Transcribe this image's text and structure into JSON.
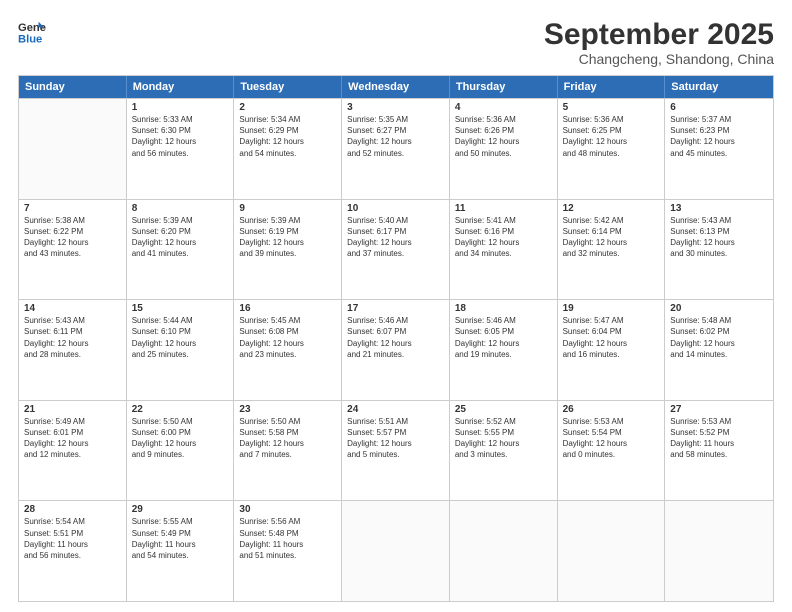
{
  "header": {
    "logo_line1": "General",
    "logo_line2": "Blue",
    "month": "September 2025",
    "location": "Changcheng, Shandong, China"
  },
  "weekdays": [
    "Sunday",
    "Monday",
    "Tuesday",
    "Wednesday",
    "Thursday",
    "Friday",
    "Saturday"
  ],
  "rows": [
    [
      {
        "day": "",
        "info": ""
      },
      {
        "day": "1",
        "info": "Sunrise: 5:33 AM\nSunset: 6:30 PM\nDaylight: 12 hours\nand 56 minutes."
      },
      {
        "day": "2",
        "info": "Sunrise: 5:34 AM\nSunset: 6:29 PM\nDaylight: 12 hours\nand 54 minutes."
      },
      {
        "day": "3",
        "info": "Sunrise: 5:35 AM\nSunset: 6:27 PM\nDaylight: 12 hours\nand 52 minutes."
      },
      {
        "day": "4",
        "info": "Sunrise: 5:36 AM\nSunset: 6:26 PM\nDaylight: 12 hours\nand 50 minutes."
      },
      {
        "day": "5",
        "info": "Sunrise: 5:36 AM\nSunset: 6:25 PM\nDaylight: 12 hours\nand 48 minutes."
      },
      {
        "day": "6",
        "info": "Sunrise: 5:37 AM\nSunset: 6:23 PM\nDaylight: 12 hours\nand 45 minutes."
      }
    ],
    [
      {
        "day": "7",
        "info": "Sunrise: 5:38 AM\nSunset: 6:22 PM\nDaylight: 12 hours\nand 43 minutes."
      },
      {
        "day": "8",
        "info": "Sunrise: 5:39 AM\nSunset: 6:20 PM\nDaylight: 12 hours\nand 41 minutes."
      },
      {
        "day": "9",
        "info": "Sunrise: 5:39 AM\nSunset: 6:19 PM\nDaylight: 12 hours\nand 39 minutes."
      },
      {
        "day": "10",
        "info": "Sunrise: 5:40 AM\nSunset: 6:17 PM\nDaylight: 12 hours\nand 37 minutes."
      },
      {
        "day": "11",
        "info": "Sunrise: 5:41 AM\nSunset: 6:16 PM\nDaylight: 12 hours\nand 34 minutes."
      },
      {
        "day": "12",
        "info": "Sunrise: 5:42 AM\nSunset: 6:14 PM\nDaylight: 12 hours\nand 32 minutes."
      },
      {
        "day": "13",
        "info": "Sunrise: 5:43 AM\nSunset: 6:13 PM\nDaylight: 12 hours\nand 30 minutes."
      }
    ],
    [
      {
        "day": "14",
        "info": "Sunrise: 5:43 AM\nSunset: 6:11 PM\nDaylight: 12 hours\nand 28 minutes."
      },
      {
        "day": "15",
        "info": "Sunrise: 5:44 AM\nSunset: 6:10 PM\nDaylight: 12 hours\nand 25 minutes."
      },
      {
        "day": "16",
        "info": "Sunrise: 5:45 AM\nSunset: 6:08 PM\nDaylight: 12 hours\nand 23 minutes."
      },
      {
        "day": "17",
        "info": "Sunrise: 5:46 AM\nSunset: 6:07 PM\nDaylight: 12 hours\nand 21 minutes."
      },
      {
        "day": "18",
        "info": "Sunrise: 5:46 AM\nSunset: 6:05 PM\nDaylight: 12 hours\nand 19 minutes."
      },
      {
        "day": "19",
        "info": "Sunrise: 5:47 AM\nSunset: 6:04 PM\nDaylight: 12 hours\nand 16 minutes."
      },
      {
        "day": "20",
        "info": "Sunrise: 5:48 AM\nSunset: 6:02 PM\nDaylight: 12 hours\nand 14 minutes."
      }
    ],
    [
      {
        "day": "21",
        "info": "Sunrise: 5:49 AM\nSunset: 6:01 PM\nDaylight: 12 hours\nand 12 minutes."
      },
      {
        "day": "22",
        "info": "Sunrise: 5:50 AM\nSunset: 6:00 PM\nDaylight: 12 hours\nand 9 minutes."
      },
      {
        "day": "23",
        "info": "Sunrise: 5:50 AM\nSunset: 5:58 PM\nDaylight: 12 hours\nand 7 minutes."
      },
      {
        "day": "24",
        "info": "Sunrise: 5:51 AM\nSunset: 5:57 PM\nDaylight: 12 hours\nand 5 minutes."
      },
      {
        "day": "25",
        "info": "Sunrise: 5:52 AM\nSunset: 5:55 PM\nDaylight: 12 hours\nand 3 minutes."
      },
      {
        "day": "26",
        "info": "Sunrise: 5:53 AM\nSunset: 5:54 PM\nDaylight: 12 hours\nand 0 minutes."
      },
      {
        "day": "27",
        "info": "Sunrise: 5:53 AM\nSunset: 5:52 PM\nDaylight: 11 hours\nand 58 minutes."
      }
    ],
    [
      {
        "day": "28",
        "info": "Sunrise: 5:54 AM\nSunset: 5:51 PM\nDaylight: 11 hours\nand 56 minutes."
      },
      {
        "day": "29",
        "info": "Sunrise: 5:55 AM\nSunset: 5:49 PM\nDaylight: 11 hours\nand 54 minutes."
      },
      {
        "day": "30",
        "info": "Sunrise: 5:56 AM\nSunset: 5:48 PM\nDaylight: 11 hours\nand 51 minutes."
      },
      {
        "day": "",
        "info": ""
      },
      {
        "day": "",
        "info": ""
      },
      {
        "day": "",
        "info": ""
      },
      {
        "day": "",
        "info": ""
      }
    ]
  ]
}
